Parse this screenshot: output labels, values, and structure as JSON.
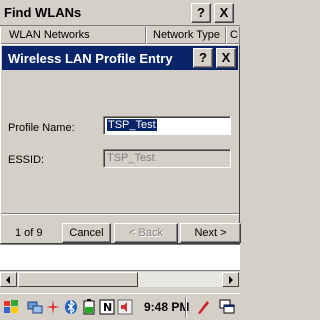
{
  "background_window": {
    "title": "Find WLANs",
    "help_label": "?",
    "close_label": "X",
    "columns": [
      "WLAN Networks",
      "Network Type",
      "C"
    ]
  },
  "dialog": {
    "title": "Wireless LAN Profile Entry",
    "help_label": "?",
    "close_label": "X",
    "profile_name_label": "Profile Name:",
    "profile_name_value": "TSP_Test",
    "essid_label": "ESSID:",
    "essid_value": "TSP_Test",
    "page_indicator": "1 of 9",
    "cancel_label": "Cancel",
    "back_label": "< Back",
    "next_label": "Next >"
  },
  "taskbar": {
    "time": "9:48 PM"
  },
  "colors": {
    "dialog_title_bg": "#0a246a",
    "window_bg": "#d4d0c8"
  }
}
